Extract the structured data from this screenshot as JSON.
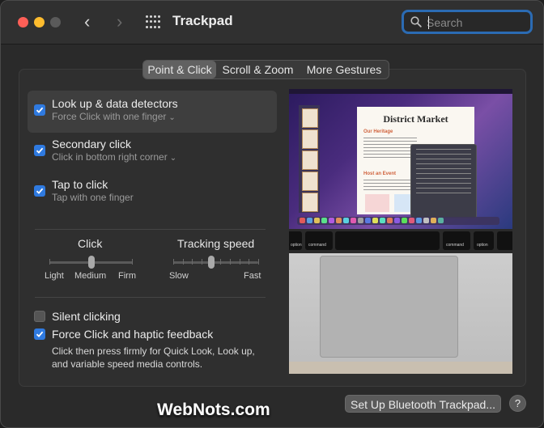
{
  "window": {
    "title": "Trackpad",
    "traffic_lights": {
      "close": "#fe5f57",
      "minimize": "#febc2e",
      "zoom": "#5a5a5a"
    }
  },
  "search": {
    "placeholder": "Search",
    "value": ""
  },
  "tabs": [
    {
      "label": "Point & Click",
      "active": true
    },
    {
      "label": "Scroll & Zoom",
      "active": false
    },
    {
      "label": "More Gestures",
      "active": false
    }
  ],
  "options": [
    {
      "label": "Look up & data detectors",
      "sub": "Force Click with one finger",
      "has_dropdown": true,
      "checked": true
    },
    {
      "label": "Secondary click",
      "sub": "Click in bottom right corner",
      "has_dropdown": true,
      "checked": true
    },
    {
      "label": "Tap to click",
      "sub": "Tap with one finger",
      "has_dropdown": false,
      "checked": true
    }
  ],
  "sliders": {
    "click": {
      "title": "Click",
      "labels": [
        "Light",
        "Medium",
        "Firm"
      ],
      "value_index": 1,
      "steps": 3
    },
    "tracking": {
      "title": "Tracking speed",
      "min_label": "Slow",
      "max_label": "Fast",
      "value_index": 4,
      "steps": 10
    }
  },
  "bottom_options": [
    {
      "label": "Silent clicking",
      "checked": false
    },
    {
      "label": "Force Click and haptic feedback",
      "checked": true
    }
  ],
  "force_click_description": "Click then press firmly for Quick Look, Look up, and variable speed media controls.",
  "preview": {
    "doc_title": "District Market",
    "doc_heading1": "Our Heritage",
    "doc_heading2": "Host an Event",
    "key_left_1": "option",
    "key_left_2": "command",
    "key_right_1": "command",
    "key_right_2": "option"
  },
  "buttons": {
    "bluetooth": "Set Up Bluetooth Trackpad...",
    "help": "?"
  },
  "watermark": "WebNots.com",
  "colors": {
    "accent": "#2f7ae0",
    "focus_ring": "#2b6bb3"
  }
}
